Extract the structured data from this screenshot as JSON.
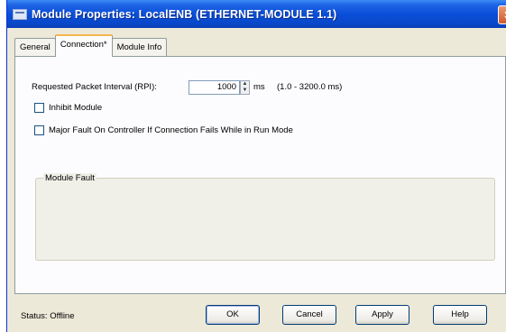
{
  "window": {
    "title": "Module Properties: LocalENB (ETHERNET-MODULE 1.1)",
    "close_glyph": "×"
  },
  "tabs": [
    {
      "label": "General",
      "active": false
    },
    {
      "label": "Connection*",
      "active": true
    },
    {
      "label": "Module Info",
      "active": false
    }
  ],
  "connection": {
    "rpi_label": "Requested Packet Interval (RPI):",
    "rpi_value": "1000",
    "rpi_unit": "ms",
    "rpi_range": "(1.0 - 3200.0 ms)",
    "inhibit_label": "Inhibit Module",
    "inhibit_checked": false,
    "major_fault_label": "Major Fault On Controller If Connection Fails While in Run Mode",
    "major_fault_checked": false,
    "module_fault_label": "Module Fault"
  },
  "status": {
    "text": "Status:  Offline"
  },
  "buttons": {
    "ok": "OK",
    "cancel": "Cancel",
    "apply": "Apply",
    "help": "Help"
  },
  "colors": {
    "titlebar": "#0a4fd8",
    "dialog_bg": "#ece9d8",
    "active_tab_accent": "#f6b64f"
  }
}
